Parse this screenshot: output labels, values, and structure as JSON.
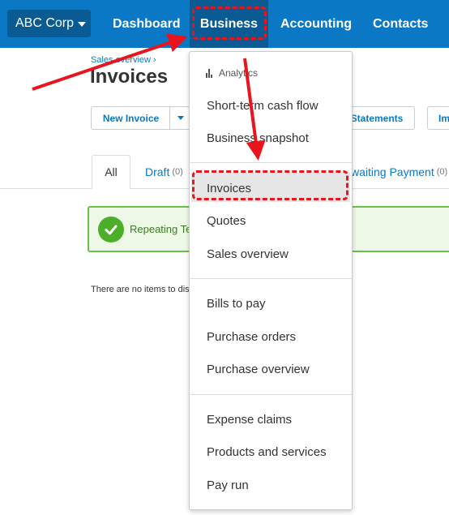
{
  "nav": {
    "org": "ABC Corp",
    "items": [
      "Dashboard",
      "Business",
      "Accounting",
      "Contacts"
    ]
  },
  "page": {
    "breadcrumb": "Sales overview ›",
    "title": "Invoices",
    "toolbar": {
      "new_invoice": "New Invoice",
      "statements": "Statements",
      "im": "Im"
    },
    "tabs": {
      "all": "All",
      "draft": "Draft",
      "draft_count": "(0)",
      "awaiting": "waiting Payment",
      "awaiting_count": "(0)"
    },
    "alert": "Repeating Te",
    "empty": "There are no items to dis"
  },
  "menu": {
    "heading": "Analytics",
    "analytics": [
      "Short-term cash flow",
      "Business snapshot"
    ],
    "sales": [
      "Invoices",
      "Quotes",
      "Sales overview"
    ],
    "purchases": [
      "Bills to pay",
      "Purchase orders",
      "Purchase overview"
    ],
    "other": [
      "Expense claims",
      "Products and services",
      "Pay run"
    ]
  },
  "colors": {
    "nav_bg": "#0b78c5",
    "nav_active": "#0a5b94",
    "annotation_red": "#e8151d",
    "success_green": "#4caf2a"
  }
}
